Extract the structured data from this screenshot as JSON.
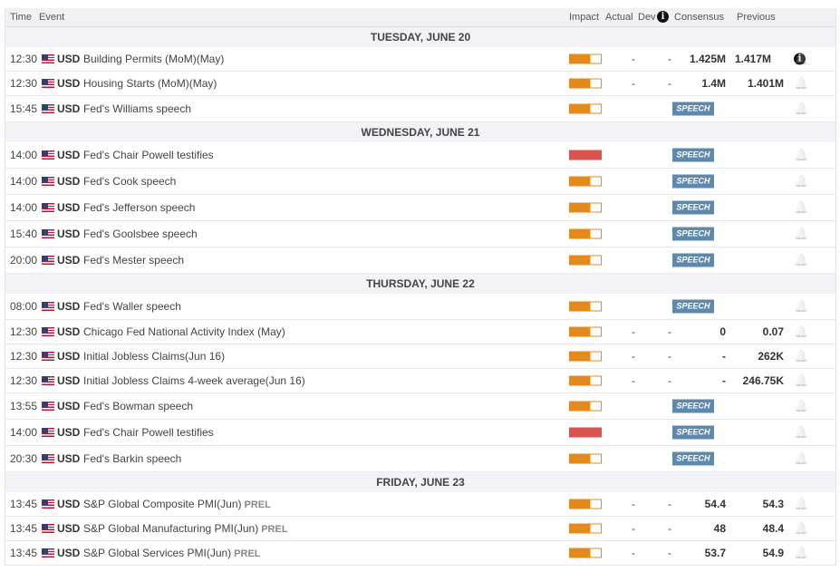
{
  "header": {
    "time": "Time",
    "event": "Event",
    "impact": "Impact",
    "actual": "Actual",
    "dev": "Dev",
    "consensus": "Consensus",
    "previous": "Previous",
    "info": "i"
  },
  "speech_label": "SPEECH",
  "colors": {
    "medium": "#e4891c",
    "high": "#d9534f",
    "speech": "#5f88ad"
  },
  "days": [
    {
      "label": "TUESDAY, JUNE 20",
      "events": [
        {
          "time": "12:30",
          "currency": "USD",
          "name": "Building Permits (MoM)(May)",
          "impact": "medium",
          "actual": "-",
          "dev": "-",
          "consensus": "1.425M",
          "previous": "1.417M",
          "previous_info": true
        },
        {
          "time": "12:30",
          "currency": "USD",
          "name": "Housing Starts (MoM)(May)",
          "impact": "medium",
          "actual": "-",
          "dev": "-",
          "consensus": "1.4M",
          "previous": "1.401M"
        },
        {
          "time": "15:45",
          "currency": "USD",
          "name": "Fed's Williams speech",
          "impact": "medium",
          "speech": true
        }
      ]
    },
    {
      "label": "WEDNESDAY, JUNE 21",
      "events": [
        {
          "time": "14:00",
          "currency": "USD",
          "name": "Fed's Chair Powell testifies",
          "impact": "high",
          "speech": true
        },
        {
          "time": "14:00",
          "currency": "USD",
          "name": "Fed's Cook speech",
          "impact": "medium",
          "speech": true
        },
        {
          "time": "14:00",
          "currency": "USD",
          "name": "Fed's Jefferson speech",
          "impact": "medium",
          "speech": true
        },
        {
          "time": "15:40",
          "currency": "USD",
          "name": "Fed's Goolsbee speech",
          "impact": "medium",
          "speech": true
        },
        {
          "time": "20:00",
          "currency": "USD",
          "name": "Fed's Mester speech",
          "impact": "medium",
          "speech": true
        }
      ]
    },
    {
      "label": "THURSDAY, JUNE 22",
      "events": [
        {
          "time": "08:00",
          "currency": "USD",
          "name": "Fed's Waller speech",
          "impact": "medium",
          "speech": true
        },
        {
          "time": "12:30",
          "currency": "USD",
          "name": "Chicago Fed National Activity Index (May)",
          "impact": "medium",
          "actual": "-",
          "dev": "-",
          "consensus": "0",
          "previous": "0.07"
        },
        {
          "time": "12:30",
          "currency": "USD",
          "name": "Initial Jobless Claims(Jun 16)",
          "impact": "medium",
          "actual": "-",
          "dev": "-",
          "consensus": "-",
          "previous": "262K"
        },
        {
          "time": "12:30",
          "currency": "USD",
          "name": "Initial Jobless Claims 4-week average(Jun 16)",
          "impact": "medium",
          "actual": "-",
          "dev": "-",
          "consensus": "-",
          "previous": "246.75K"
        },
        {
          "time": "13:55",
          "currency": "USD",
          "name": "Fed's Bowman speech",
          "impact": "medium",
          "speech": true
        },
        {
          "time": "14:00",
          "currency": "USD",
          "name": "Fed's Chair Powell testifies",
          "impact": "high",
          "speech": true
        },
        {
          "time": "20:30",
          "currency": "USD",
          "name": "Fed's Barkin speech",
          "impact": "medium",
          "speech": true
        }
      ]
    },
    {
      "label": "FRIDAY, JUNE 23",
      "events": [
        {
          "time": "13:45",
          "currency": "USD",
          "name": "S&P Global Composite PMI(Jun)",
          "tag": "PREL",
          "impact": "medium",
          "actual": "-",
          "dev": "-",
          "consensus": "54.4",
          "previous": "54.3"
        },
        {
          "time": "13:45",
          "currency": "USD",
          "name": "S&P Global Manufacturing PMI(Jun)",
          "tag": "PREL",
          "impact": "medium",
          "actual": "-",
          "dev": "-",
          "consensus": "48",
          "previous": "48.4"
        },
        {
          "time": "13:45",
          "currency": "USD",
          "name": "S&P Global Services PMI(Jun)",
          "tag": "PREL",
          "impact": "medium",
          "actual": "-",
          "dev": "-",
          "consensus": "53.7",
          "previous": "54.9"
        }
      ]
    }
  ]
}
